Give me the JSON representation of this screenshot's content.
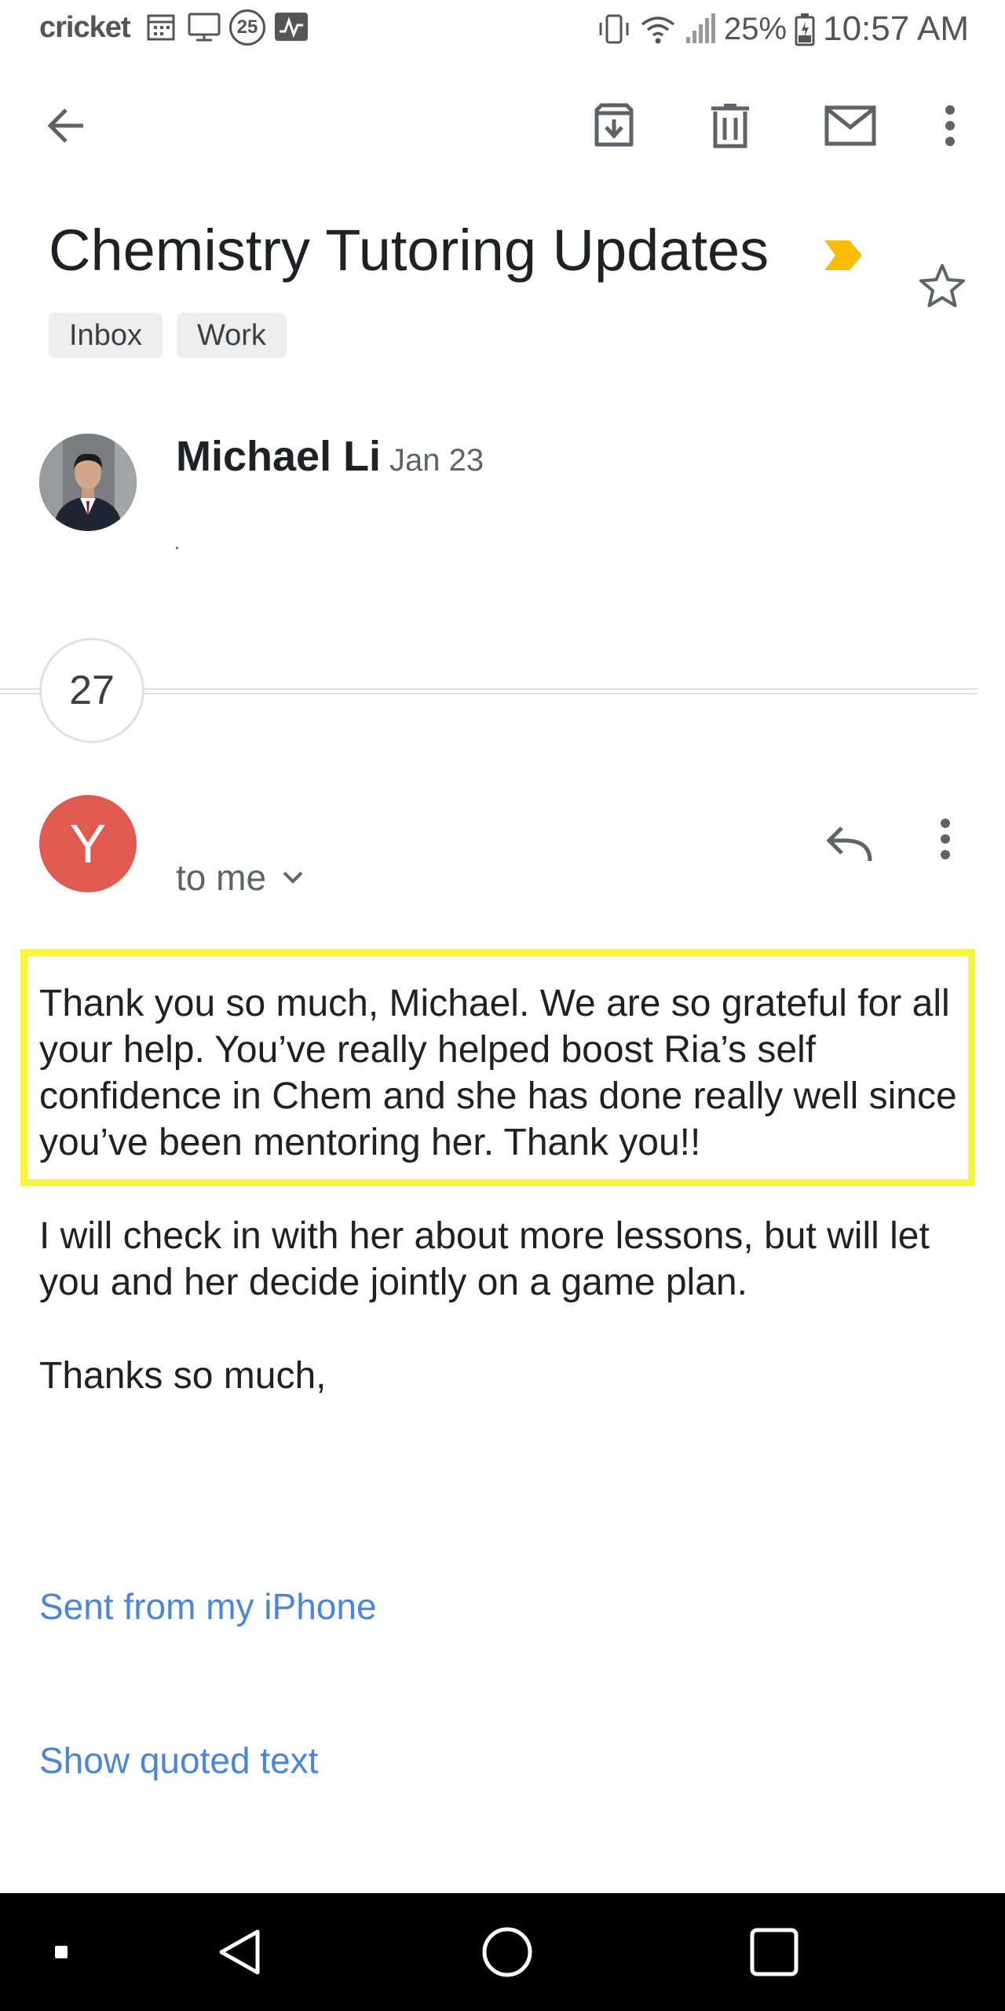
{
  "status_bar": {
    "carrier": "cricket",
    "notification_badge": "25",
    "battery": "25%",
    "time": "10:57 AM"
  },
  "toolbar": {
    "back_icon": "arrow-back-icon",
    "archive_icon": "archive-icon",
    "delete_icon": "trash-icon",
    "mark_unread_icon": "mail-icon",
    "more_icon": "more-vertical-icon"
  },
  "thread": {
    "subject": "Chemistry Tutoring Updates",
    "labels": [
      "Inbox",
      "Work"
    ],
    "important_color": "#fbbc04",
    "collapsed_message": {
      "sender": "Michael Li",
      "date": "Jan 23"
    },
    "hidden_count": "27",
    "message": {
      "avatar_letter": "Y",
      "avatar_color": "#e05a4f",
      "recipient": "to me",
      "paragraphs": [
        "Thank you so much, Michael. We are so grateful for all your help. You’ve really helped boost Ria’s self confidence in Chem and she has done really well since you’ve been mentoring her. Thank you!!",
        "I will check in with her about more lessons, but will let you and her decide jointly on a game plan.",
        "Thanks so much,"
      ],
      "signature_link": "Sent from my iPhone",
      "quoted_link": "Show quoted text"
    }
  },
  "highlight_color": "#f7f53c",
  "link_color": "#4a86d8"
}
